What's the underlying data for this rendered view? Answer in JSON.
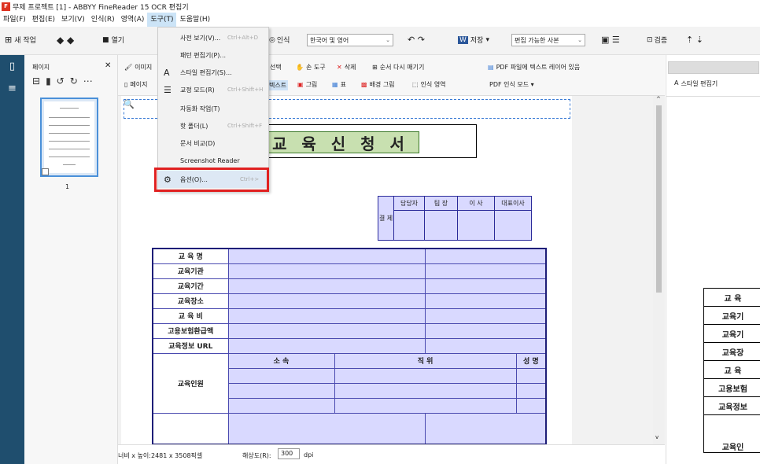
{
  "window": {
    "title": "무제 프로젝트 [1] - ABBYY FineReader 15 OCR 편집기"
  },
  "menu": [
    "파일(F)",
    "편집(E)",
    "보기(V)",
    "인식(R)",
    "영역(A)",
    "도구(T)",
    "도움말(H)"
  ],
  "toolbar": {
    "new_task": "새 작업",
    "open": "열기",
    "recognize": "인식",
    "lang": "한국어 및 영어",
    "save": "저장",
    "save_mode": "편집 가능한 사본",
    "verify": "검증"
  },
  "pages_panel": {
    "title": "페이지",
    "page_number": "1"
  },
  "image_tools": {
    "image": "이미지",
    "page": "페이지",
    "select": "선택",
    "hand": "손 도구",
    "delete": "삭제",
    "reorder": "순서 다시 매기기",
    "text": "텍스트",
    "picture": "그림",
    "table": "표",
    "bg_picture": "배경 그림",
    "recog_area": "인식 영역",
    "pdf_layer": "PDF 파일에 텍스트 레이어 있음",
    "pdf_mode": "PDF 인식 모드 ▾"
  },
  "right_panel": {
    "style_edit": "스타일 편집기",
    "rows": [
      "교 육",
      "교육기",
      "교육기",
      "교육장",
      "교 육",
      "고용보험",
      "교육정보",
      "교육인"
    ]
  },
  "document": {
    "title": "교 육 신 청 서",
    "approval_side": "결 제",
    "approval_heads": [
      "담당자",
      "팀 장",
      "이 사",
      "대표이사"
    ],
    "rows": [
      "교 육 명",
      "교육기관",
      "교육기간",
      "교육장소",
      "교 육 비",
      "고용보험환급액",
      "교육정보 URL"
    ],
    "trainee_label": "교육인원",
    "trainee_heads": [
      "소 속",
      "직 위",
      "성 명"
    ]
  },
  "status": {
    "size_label": "너비 x 높이:",
    "size_value": "2481 x 3508픽셀",
    "res_label": "해상도(R):",
    "res_value": "300",
    "res_unit": "dpi"
  },
  "tools_menu": [
    {
      "label": "사전 보기(V)...",
      "shortcut": "Ctrl+Alt+D"
    },
    {
      "label": "패턴 편집기(P)...",
      "shortcut": ""
    },
    {
      "label": "스타일 편집기(S)...",
      "shortcut": ""
    },
    {
      "label": "교정 모드(R)",
      "shortcut": "Ctrl+Shift+H"
    },
    {
      "label": "자동화 작업(T)",
      "shortcut": ""
    },
    {
      "label": "핫 폴더(L)",
      "shortcut": "Ctrl+Shift+F"
    },
    {
      "label": "문서 비교(D)",
      "shortcut": ""
    },
    {
      "label": "Screenshot Reader",
      "shortcut": ""
    },
    {
      "label": "옵션(O)...",
      "shortcut": "Ctrl+>"
    }
  ]
}
